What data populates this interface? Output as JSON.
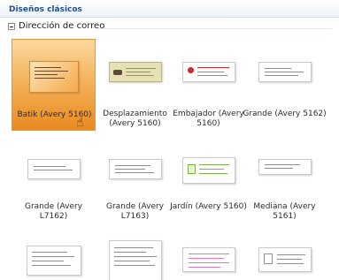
{
  "header": {
    "title": "Diseños clásicos"
  },
  "group": {
    "label": "Dirección de correo",
    "collapse_symbol": "⊟"
  },
  "tiles": [
    {
      "label": "Batik (Avery 5160)",
      "selected": true,
      "icon": "batik-label-thumbnail-icon"
    },
    {
      "label": "Desplazamiento (Avery 5160)",
      "selected": false,
      "icon": "scroll-label-thumbnail-icon"
    },
    {
      "label": "Embajador (Avery 5160)",
      "selected": false,
      "icon": "ambassador-label-thumbnail-icon"
    },
    {
      "label": "Grande (Avery 5162)",
      "selected": false,
      "icon": "large-label-thumbnail-icon"
    },
    {
      "label": "Grande (Avery L7162)",
      "selected": false,
      "icon": "large-label-thumbnail-icon"
    },
    {
      "label": "Grande (Avery L7163)",
      "selected": false,
      "icon": "large-label-thumbnail-icon"
    },
    {
      "label": "Jardín (Avery 5160)",
      "selected": false,
      "icon": "garden-label-thumbnail-icon"
    },
    {
      "label": "Mediana (Avery 5161)",
      "selected": false,
      "icon": "medium-label-thumbnail-icon"
    },
    {
      "label": "",
      "selected": false,
      "icon": "label-thumbnail-icon"
    },
    {
      "label": "",
      "selected": false,
      "icon": "label-thumbnail-icon"
    },
    {
      "label": "",
      "selected": false,
      "icon": "pink-lines-label-thumbnail-icon"
    },
    {
      "label": "",
      "selected": false,
      "icon": "framed-label-thumbnail-icon"
    }
  ],
  "colors": {
    "selection": "#f4b35a",
    "header_text": "#1f4d8c",
    "scroll_band": "#e6e2b4",
    "garden_green": "#7fb04a",
    "pink_lines": "#e07ab0",
    "ambassador_red": "#cc2b2b"
  }
}
